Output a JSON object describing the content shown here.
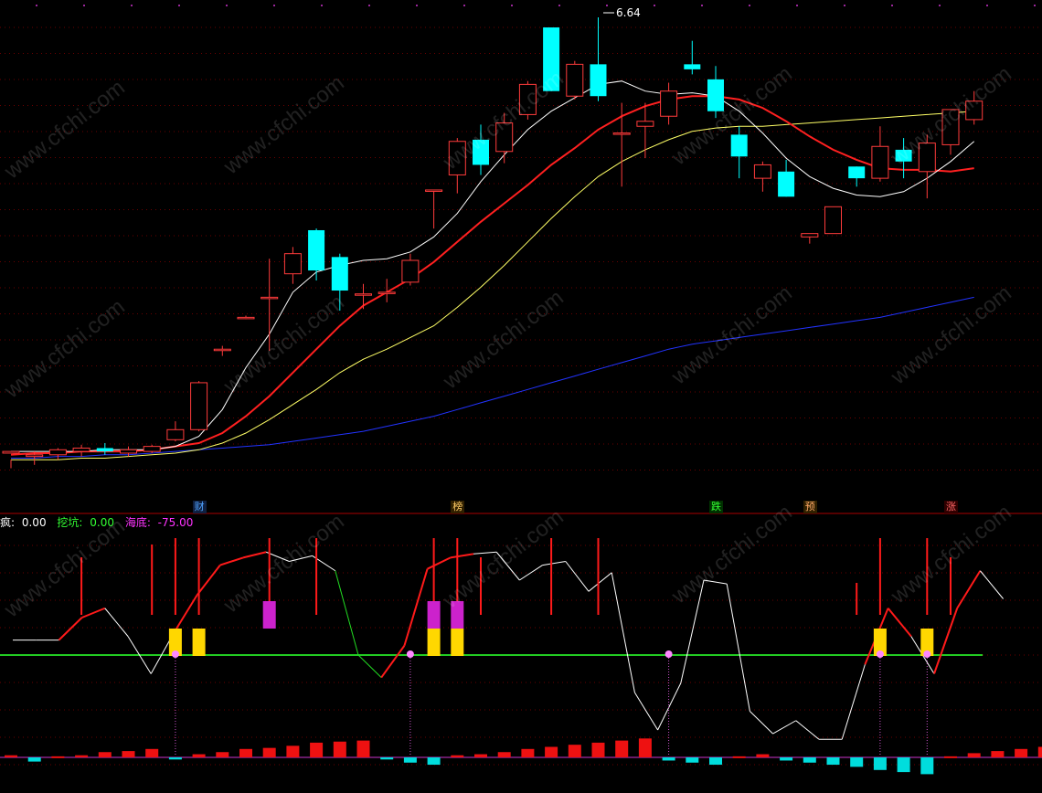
{
  "watermark": "www.cfchi.com",
  "header": {
    "label1": "疯: ",
    "value1": "0.00",
    "label2": "挖坑: ",
    "value2": "0.00",
    "label3": "海底: ",
    "value3": "-75.00"
  },
  "price_label": "6.64",
  "events": [
    {
      "bar": 8,
      "text": "财",
      "color": "#4fa3ff",
      "bg": "#102040"
    },
    {
      "bar": 19,
      "text": "榜",
      "color": "#ffcc66",
      "bg": "#302000"
    },
    {
      "bar": 30,
      "text": "跌",
      "color": "#33ff33",
      "bg": "#003000"
    },
    {
      "bar": 34,
      "text": "预",
      "color": "#ffaa66",
      "bg": "#302000"
    },
    {
      "bar": 40,
      "text": "涨",
      "color": "#ff6666",
      "bg": "#300000"
    }
  ],
  "colors": {
    "up": "#ff3b3b",
    "down": "#00ffff",
    "ma5": "#ffffff",
    "ma10": "#ff2020",
    "ma20": "#ffff66",
    "ma60": "#2233ff",
    "grid": "#6a0000",
    "osc": "#ffffff",
    "osc_base": "#22cc22",
    "signal": "#ff1a1a",
    "yellow": "#ffd700",
    "magenta": "#cc22cc"
  },
  "chart_data": {
    "type": "candlestick",
    "candles": [
      [
        4.04,
        4.05,
        4.0,
        3.95
      ],
      [
        4.02,
        4.03,
        4.05,
        3.97
      ],
      [
        4.03,
        4.06,
        4.07,
        4.0
      ],
      [
        4.05,
        4.07,
        4.09,
        4.02
      ],
      [
        4.07,
        4.05,
        4.1,
        4.03
      ],
      [
        4.04,
        4.06,
        4.08,
        4.02
      ],
      [
        4.05,
        4.08,
        4.09,
        4.04
      ],
      [
        4.12,
        4.18,
        4.23,
        4.11
      ],
      [
        4.18,
        4.46,
        4.47,
        4.17
      ],
      [
        4.66,
        4.66,
        4.68,
        4.62
      ],
      [
        4.85,
        4.85,
        4.86,
        4.84
      ],
      [
        4.97,
        4.97,
        5.2,
        4.65
      ],
      [
        5.11,
        5.23,
        5.27,
        5.05
      ],
      [
        5.37,
        5.13,
        5.38,
        5.07
      ],
      [
        5.21,
        5.01,
        5.23,
        4.89
      ],
      [
        4.99,
        4.99,
        5.05,
        4.9
      ],
      [
        5.0,
        5.0,
        5.08,
        4.94
      ],
      [
        5.06,
        5.19,
        5.23,
        5.04
      ],
      [
        5.61,
        5.61,
        5.61,
        5.38
      ],
      [
        5.7,
        5.9,
        5.92,
        5.59
      ],
      [
        5.91,
        5.76,
        6.0,
        5.7
      ],
      [
        5.84,
        6.01,
        6.07,
        5.77
      ],
      [
        6.06,
        6.24,
        6.26,
        6.03
      ],
      [
        6.58,
        6.2,
        6.58,
        6.2
      ],
      [
        6.17,
        6.36,
        6.38,
        6.15
      ],
      [
        6.36,
        6.17,
        6.64,
        6.14
      ],
      [
        5.95,
        5.95,
        6.13,
        5.63
      ],
      [
        5.99,
        6.02,
        6.13,
        5.8
      ],
      [
        6.05,
        6.2,
        6.25,
        6.0
      ],
      [
        6.36,
        6.33,
        6.5,
        6.3
      ],
      [
        6.27,
        6.08,
        6.35,
        6.04
      ],
      [
        5.94,
        5.81,
        5.99,
        5.68
      ],
      [
        5.68,
        5.76,
        5.78,
        5.6
      ],
      [
        5.72,
        5.57,
        5.79,
        5.57
      ],
      [
        5.33,
        5.35,
        5.35,
        5.29
      ],
      [
        5.35,
        5.51,
        5.51,
        5.35
      ],
      [
        5.75,
        5.68,
        5.75,
        5.63
      ],
      [
        5.68,
        5.87,
        5.99,
        5.66
      ],
      [
        5.85,
        5.78,
        5.92,
        5.68
      ],
      [
        5.72,
        5.89,
        5.94,
        5.56
      ],
      [
        5.88,
        6.09,
        6.09,
        5.82
      ],
      [
        6.03,
        6.14,
        6.2,
        6.0
      ]
    ],
    "ma5": [
      4.05,
      4.05,
      4.05,
      4.05,
      4.06,
      4.06,
      4.06,
      4.08,
      4.14,
      4.3,
      4.55,
      4.75,
      5.0,
      5.12,
      5.16,
      5.19,
      5.2,
      5.24,
      5.33,
      5.47,
      5.66,
      5.82,
      5.97,
      6.08,
      6.16,
      6.24,
      6.26,
      6.2,
      6.18,
      6.19,
      6.17,
      6.08,
      5.95,
      5.8,
      5.69,
      5.62,
      5.58,
      5.57,
      5.6,
      5.68,
      5.78,
      5.9
    ],
    "ma10": [
      4.03,
      4.04,
      4.04,
      4.05,
      4.05,
      4.05,
      4.06,
      4.08,
      4.1,
      4.16,
      4.26,
      4.38,
      4.52,
      4.66,
      4.8,
      4.92,
      5.0,
      5.08,
      5.18,
      5.3,
      5.42,
      5.53,
      5.64,
      5.76,
      5.86,
      5.97,
      6.05,
      6.11,
      6.15,
      6.17,
      6.17,
      6.15,
      6.1,
      6.02,
      5.93,
      5.85,
      5.79,
      5.74,
      5.73,
      5.73,
      5.72,
      5.74
    ],
    "ma20": [
      4.0,
      4.0,
      4.0,
      4.01,
      4.01,
      4.02,
      4.03,
      4.04,
      4.06,
      4.1,
      4.16,
      4.24,
      4.33,
      4.42,
      4.52,
      4.6,
      4.66,
      4.73,
      4.8,
      4.91,
      5.03,
      5.16,
      5.3,
      5.44,
      5.57,
      5.69,
      5.78,
      5.85,
      5.91,
      5.96,
      5.98,
      5.99,
      5.99,
      6.0,
      6.01,
      6.02,
      6.03,
      6.04,
      6.05,
      6.06,
      6.07,
      6.08
    ],
    "ma60": [
      4.01,
      4.01,
      4.02,
      4.02,
      4.03,
      4.03,
      4.04,
      4.05,
      4.06,
      4.07,
      4.08,
      4.09,
      4.11,
      4.13,
      4.15,
      4.17,
      4.2,
      4.23,
      4.26,
      4.3,
      4.34,
      4.38,
      4.42,
      4.46,
      4.5,
      4.54,
      4.58,
      4.62,
      4.66,
      4.69,
      4.71,
      4.73,
      4.75,
      4.77,
      4.79,
      4.81,
      4.83,
      4.85,
      4.88,
      4.91,
      4.94,
      4.97
    ],
    "osc": [
      8,
      8,
      8,
      20,
      25,
      10,
      -10,
      12,
      32,
      48,
      52,
      55,
      50,
      53,
      45,
      0,
      -12,
      5,
      46,
      52,
      54,
      55,
      40,
      48,
      50,
      34,
      44,
      -20,
      -40,
      -15,
      40,
      38,
      -30,
      -42,
      -35,
      -45,
      -45,
      -5,
      25,
      10,
      -10,
      25,
      45,
      30
    ],
    "osc_line_color": [
      "w",
      "w",
      "r",
      "r",
      "w",
      "w",
      "w",
      "r",
      "r",
      "r",
      "r",
      "w",
      "w",
      "w",
      "g",
      "g",
      "r",
      "r",
      "r",
      "r",
      "w",
      "w",
      "w",
      "w",
      "w",
      "w",
      "w",
      "w",
      "w",
      "w",
      "w",
      "w",
      "w",
      "w",
      "w",
      "w",
      "w",
      "r",
      "r",
      "w",
      "r",
      "r",
      "w"
    ],
    "osc_base": 0,
    "signal_bars": [
      [
        3,
        45
      ],
      [
        6,
        55
      ],
      [
        7,
        60
      ],
      [
        8,
        60
      ],
      [
        11,
        60
      ],
      [
        13,
        60
      ],
      [
        18,
        60
      ],
      [
        19,
        60
      ],
      [
        20,
        45
      ],
      [
        23,
        60
      ],
      [
        25,
        60
      ],
      [
        36,
        25
      ],
      [
        37,
        60
      ],
      [
        39,
        60
      ],
      [
        40,
        45
      ]
    ],
    "yellow_bars": [
      7,
      8,
      18,
      19,
      37,
      39
    ],
    "magenta_bars": [
      11,
      18,
      19
    ],
    "markers": [
      7,
      17,
      28,
      37,
      39
    ],
    "hist": [
      2,
      -4,
      1,
      2,
      5,
      6,
      8,
      -2,
      3,
      5,
      8,
      9,
      11,
      14,
      15,
      16,
      -2,
      -5,
      -7,
      2,
      3,
      5,
      8,
      10,
      12,
      14,
      16,
      18,
      -3,
      -5,
      -7,
      1,
      3,
      -3,
      -5,
      -7,
      -9,
      -12,
      -14,
      -16,
      1,
      4,
      6,
      8,
      10
    ]
  }
}
